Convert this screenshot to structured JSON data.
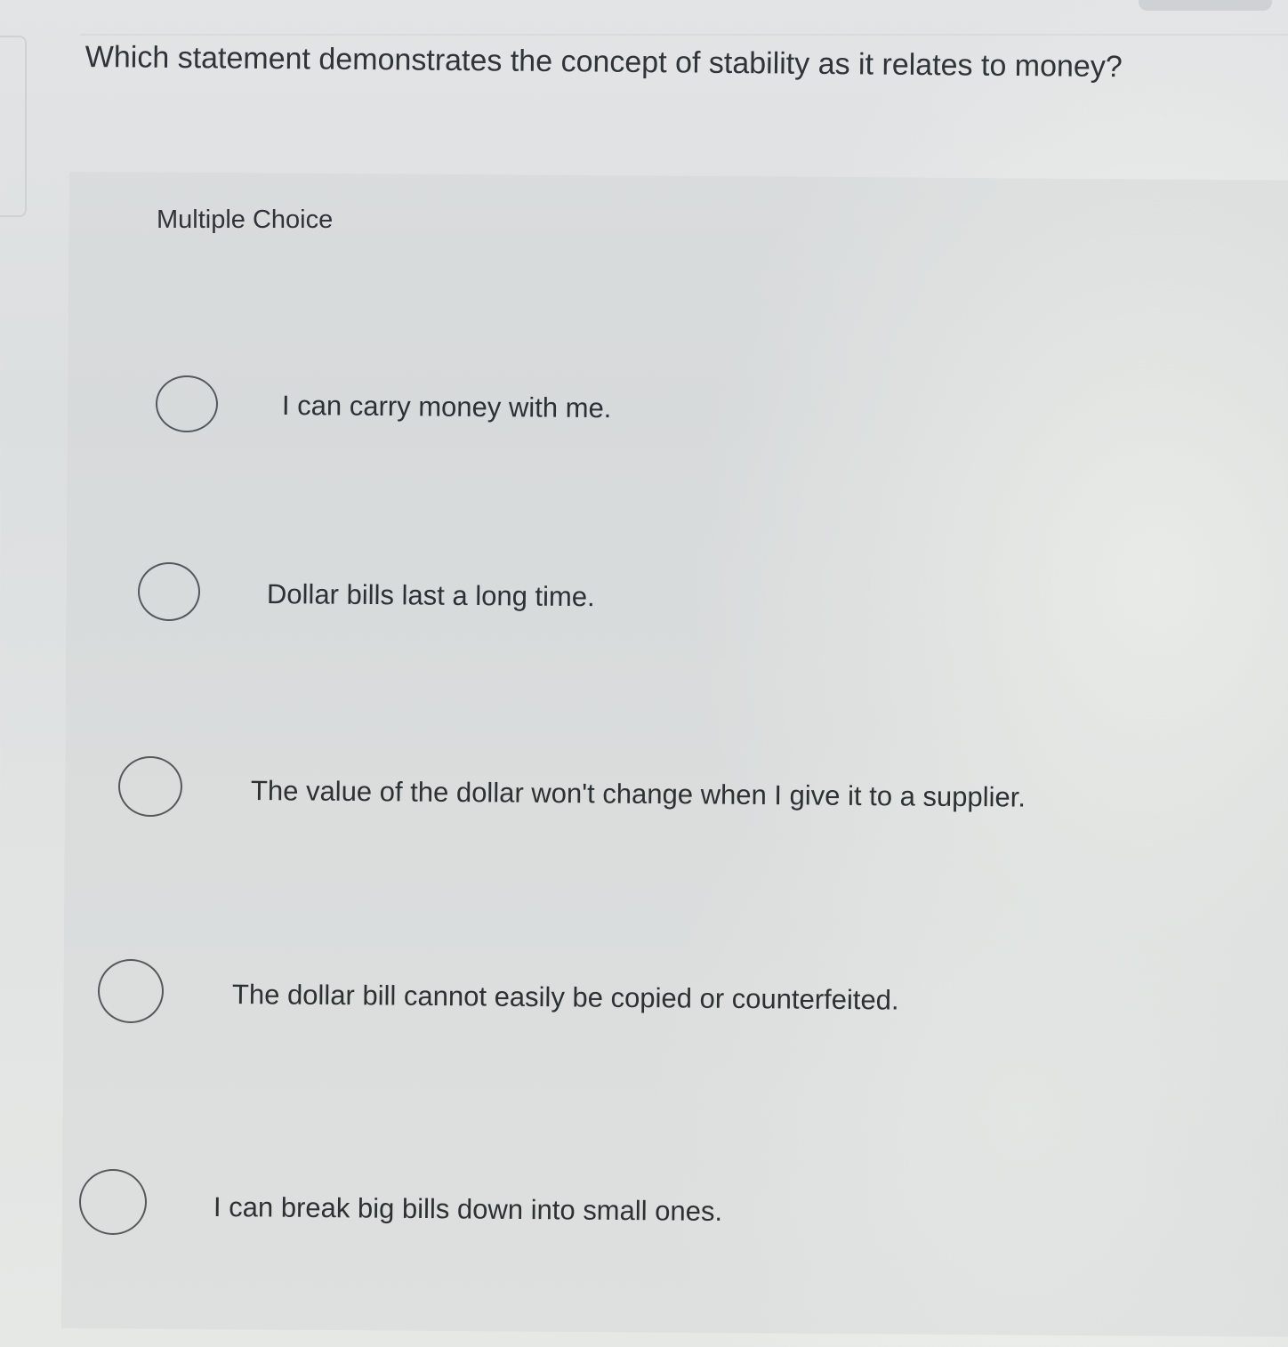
{
  "question": {
    "text": "Which statement demonstrates the concept of stability as it relates to money?"
  },
  "choice": {
    "header": "Multiple Choice",
    "options": [
      {
        "label": "I can carry money with me."
      },
      {
        "label": "Dollar bills last a long time."
      },
      {
        "label": "The value of the dollar won't change when I give it to a supplier."
      },
      {
        "label": "The dollar bill cannot easily be copied or counterfeited."
      },
      {
        "label": "I can break big bills down into small ones."
      }
    ]
  }
}
